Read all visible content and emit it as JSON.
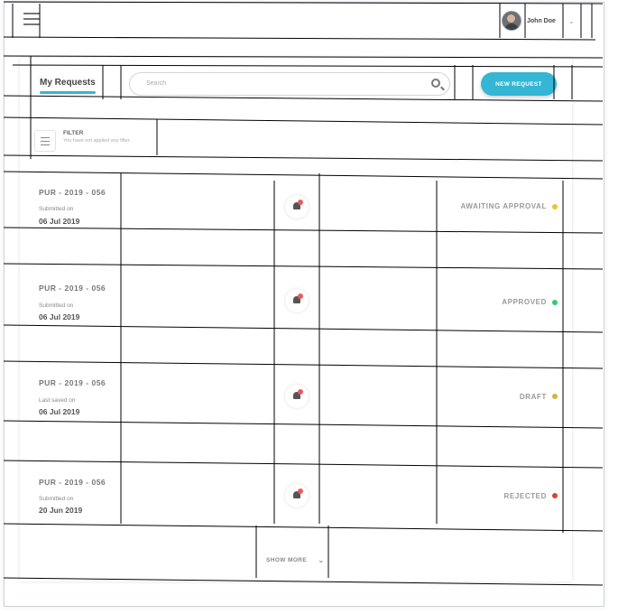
{
  "header": {
    "user_name": "John Doe",
    "menu_icon": "hamburger-icon",
    "dropdown_icon": "chevron-down-icon"
  },
  "toolbar": {
    "tab_label": "My Requests",
    "search_placeholder": "Search",
    "new_request_label": "NEW REQUEST"
  },
  "filter": {
    "title": "FILTER",
    "subtitle": "You have not applied any filter."
  },
  "requests": [
    {
      "id": "PUR - 2019 - 056",
      "date_label": "Submitted on",
      "date": "06 Jul 2019",
      "status": "AWAITING APPROVAL",
      "status_color": "#f2c12e"
    },
    {
      "id": "PUR - 2019 - 056",
      "date_label": "Submitted on",
      "date": "06 Jul 2019",
      "status": "APPROVED",
      "status_color": "#2ecc71"
    },
    {
      "id": "PUR - 2019 - 056",
      "date_label": "Last saved on",
      "date": "06 Jul 2019",
      "status": "DRAFT",
      "status_color": "#d4b43a"
    },
    {
      "id": "PUR - 2019 - 056",
      "date_label": "Submitted on",
      "date": "20 Jun 2019",
      "status": "REJECTED",
      "status_color": "#d9442e"
    }
  ],
  "footer": {
    "show_more_label": "SHOW MORE"
  },
  "colors": {
    "accent": "#34b6d4",
    "notification_dot": "#ef5a5a"
  }
}
